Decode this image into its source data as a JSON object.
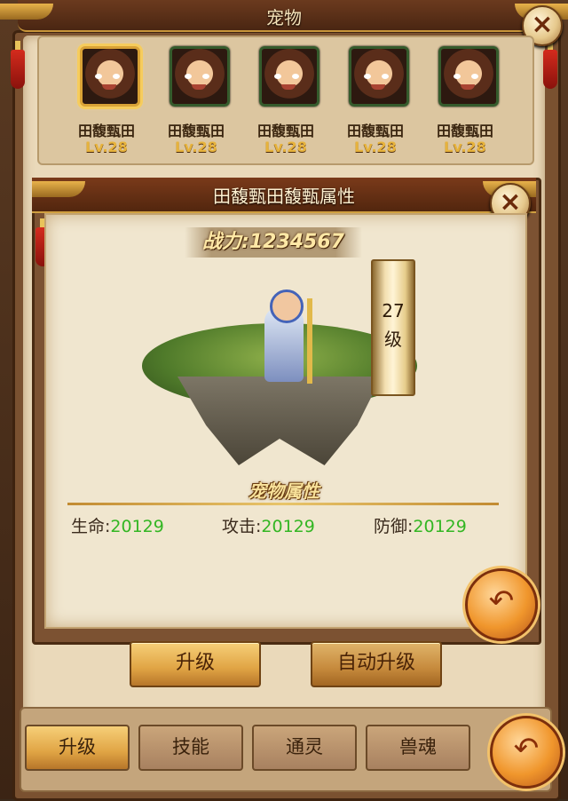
{
  "window": {
    "title": "宠物",
    "close_glyph": "×"
  },
  "pets": [
    {
      "name": "田馥甄田",
      "level": "Lv.28",
      "selected": true
    },
    {
      "name": "田馥甄田",
      "level": "Lv.28",
      "selected": false
    },
    {
      "name": "田馥甄田",
      "level": "Lv.28",
      "selected": false
    },
    {
      "name": "田馥甄田",
      "level": "Lv.28",
      "selected": false
    },
    {
      "name": "田馥甄田",
      "level": "Lv.28",
      "selected": false
    }
  ],
  "popup": {
    "title": "田馥甄田馥甄属性",
    "close_glyph": "×",
    "power_label": "战力:",
    "power_value": "1234567",
    "level_number": "27",
    "level_unit": "级",
    "attributes_title": "宠物属性",
    "attributes": [
      {
        "label": "生命:",
        "value": "20129"
      },
      {
        "label": "攻击:",
        "value": "20129"
      },
      {
        "label": "防御:",
        "value": "20129"
      }
    ],
    "back_glyph": "↶"
  },
  "actions": {
    "upgrade": "升级",
    "auto_upgrade": "自动升级"
  },
  "tabs": [
    {
      "label": "升级",
      "active": true
    },
    {
      "label": "技能",
      "active": false
    },
    {
      "label": "通灵",
      "active": false
    },
    {
      "label": "兽魂",
      "active": false
    }
  ],
  "main_back_glyph": "↶",
  "colors": {
    "value_green": "#33b623",
    "gold": "#e7b33c",
    "selected_border": "#d9a236"
  }
}
